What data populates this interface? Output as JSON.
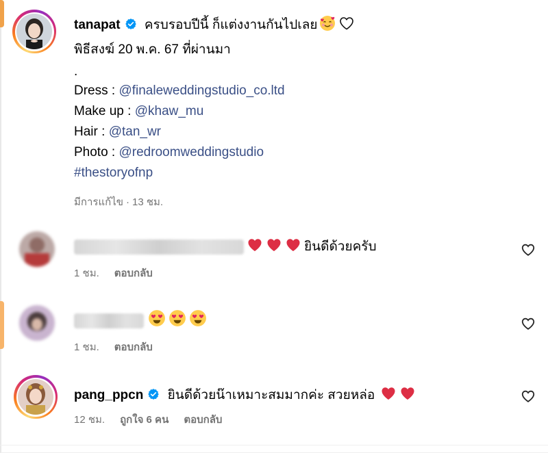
{
  "post": {
    "username": "tanapat",
    "caption_first": "ครบรอบปีนี้ ก็แต่งงานกันไปเลย",
    "caption_line2": "พิธีสงฆ์ 20 พ.ค. 67 ที่ผ่านมา",
    "caption_dot": ".",
    "dress_label": "Dress : ",
    "dress_link": "@finaleweddingstudio_co.ltd",
    "makeup_label": "Make up : ",
    "makeup_link": "@khaw_mu",
    "hair_label": "Hair : ",
    "hair_link": "@tan_wr",
    "photo_label": "Photo : ",
    "photo_link": "@redroomweddingstudio",
    "hashtag": "#thestoryofnp",
    "edited_label": "มีการแก้ไข",
    "separator": "·",
    "time": "13 ชม."
  },
  "comments": [
    {
      "text": "ยินดีด้วยครับ",
      "time": "1 ชม.",
      "reply_label": "ตอบกลับ"
    },
    {
      "time": "1 ชม.",
      "reply_label": "ตอบกลับ"
    },
    {
      "username": "pang_ppcn",
      "text": "ยินดีด้วยน๊าเหมาะสมมากค่ะ สวยหล่อ",
      "time": "12 ชม.",
      "likes_label": "ถูกใจ 6 คน",
      "reply_label": "ตอบกลับ"
    }
  ],
  "icons": {
    "verified": "verified-badge-icon",
    "like": "heart-outline-icon",
    "red_heart": "red-heart-emoji",
    "smiling_face_hearts": "smiling-face-with-hearts-emoji",
    "heart_eyes": "heart-eyes-emoji"
  },
  "colors": {
    "link": "#3a4f86",
    "muted": "#737373",
    "verified": "#0095f6",
    "heart": "#e0245e"
  }
}
